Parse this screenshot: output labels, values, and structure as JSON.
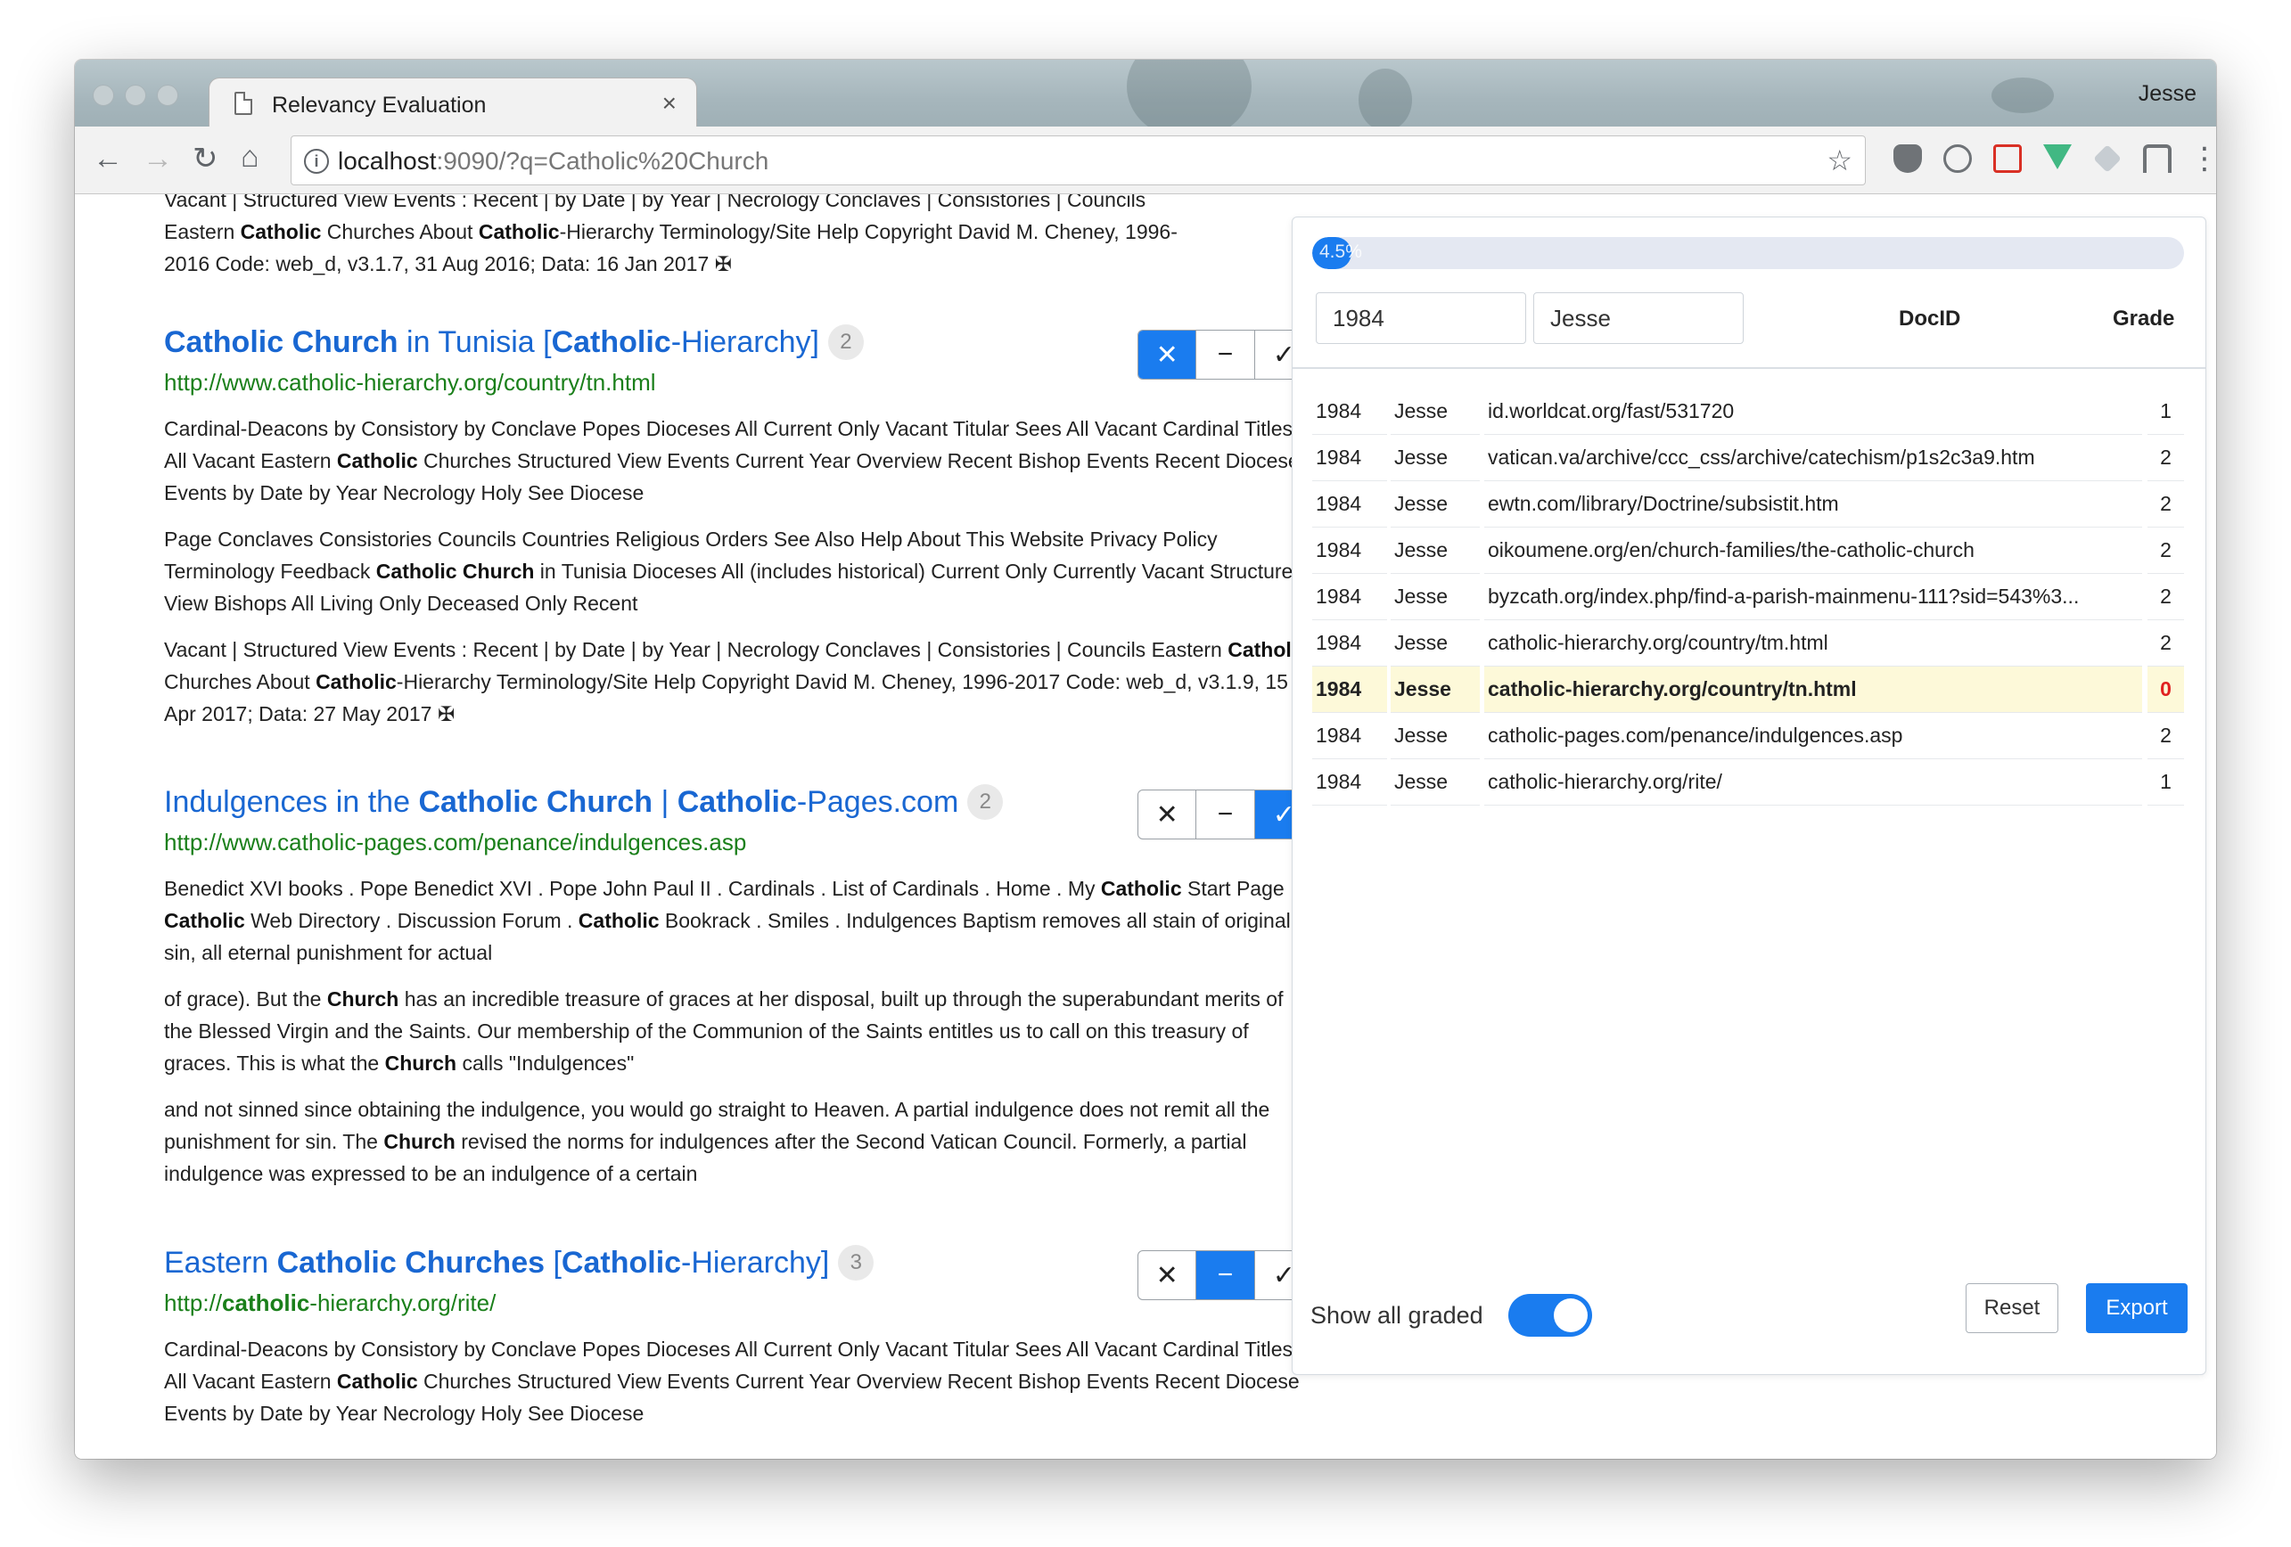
{
  "browser": {
    "tab_title": "Relevancy Evaluation",
    "tab_close": "×",
    "profile_name": "Jesse",
    "url_host": "localhost",
    "url_rest": ":9090/?q=Catholic%20Church"
  },
  "results": {
    "top_fragment": {
      "line1": "Vacant | Structured View Events : Recent | by Date | by Year | Necrology Conclaves | Consistories | Councils",
      "line2_a": "Eastern ",
      "line2_b": "Catholic",
      "line2_c": " Churches About ",
      "line2_d": "Catholic",
      "line2_e": "-Hierarchy Terminology/Site Help Copyright David M. Cheney, 1996-",
      "line3": "2016 Code: web_d, v3.1.7, 31 Aug 2016; Data: 16 Jan 2017 ✠"
    },
    "r1": {
      "title_a": "Catholic Church",
      "title_b": " in Tunisia [",
      "title_c": "Catholic",
      "title_d": "-Hierarchy]",
      "badge": "2",
      "url": "http://www.catholic-hierarchy.org/country/tn.html",
      "p1_a": "Cardinal-Deacons by Consistory by Conclave Popes Dioceses All Current Only Vacant Titular Sees All Vacant Cardinal Titles All Vacant Eastern ",
      "p1_b": "Catholic",
      "p1_c": " Churches Structured View Events Current Year Overview Recent Bishop Events Recent Diocese Events by Date by Year Necrology Holy See Diocese",
      "p2_a": "Page Conclaves Consistories Councils Countries Religious Orders See Also Help About This Website Privacy Policy Terminology Feedback ",
      "p2_b": "Catholic Church",
      "p2_c": " in Tunisia Dioceses All (includes historical) Current Only Currently Vacant Structured View Bishops All Living Only Deceased Only Recent",
      "p3_a": "Vacant | Structured View Events : Recent | by Date | by Year | Necrology Conclaves | Consistories | Councils Eastern ",
      "p3_b": "Catholic",
      "p3_c": " Churches About ",
      "p3_d": "Catholic",
      "p3_e": "-Hierarchy Terminology/Site Help Copyright David M. Cheney, 1996-2017 Code: web_d, v3.1.9, 15 Apr 2017; Data: 27 May 2017 ✠"
    },
    "r2": {
      "title_a": "Indulgences in the ",
      "title_b": "Catholic Church",
      "title_c": " | ",
      "title_d": "Catholic",
      "title_e": "-Pages.com",
      "badge": "2",
      "url": "http://www.catholic-pages.com/penance/indulgences.asp",
      "p1_a": "Benedict XVI books  .  Pope Benedict XVI  .  Pope John Paul II  .  Cardinals  .  List of Cardinals  .  Home  .  My ",
      "p1_b": "Catholic",
      "p1_c": " Start Page  .  ",
      "p1_d": "Catholic",
      "p1_e": " Web Directory  .  Discussion Forum  .  ",
      "p1_f": "Catholic",
      "p1_g": " Bookrack  .  Smiles  .  Indulgences Baptism removes all stain of original sin, all eternal punishment for actual",
      "p2_a": "of grace). But the ",
      "p2_b": "Church",
      "p2_c": " has an incredible treasure of graces at her disposal, built up through the superabundant merits of the Blessed Virgin and the Saints. Our membership of the Communion of the Saints entitles us to call on this treasury of graces. This is what the ",
      "p2_d": "Church",
      "p2_e": " calls \"Indulgences\"",
      "p3_a": "and not sinned since obtaining the indulgence, you would go straight to Heaven. A partial indulgence does not remit all the punishment for sin. The ",
      "p3_b": "Church",
      "p3_c": " revised the norms for indulgences after the Second Vatican Council. Formerly, a partial indulgence was expressed to be an indulgence of a certain"
    },
    "r3": {
      "title_a": "Eastern ",
      "title_b": "Catholic Churches",
      "title_c": " [",
      "title_d": "Catholic",
      "title_e": "-Hierarchy]",
      "badge": "3",
      "url_a": "http://",
      "url_b": "catholic",
      "url_c": "-hierarchy.org/rite/",
      "p1_a": "Cardinal-Deacons by Consistory by Conclave Popes Dioceses All Current Only Vacant Titular Sees All Vacant Cardinal Titles All Vacant Eastern ",
      "p1_b": "Catholic",
      "p1_c": " Churches Structured View Events Current Year Overview Recent Bishop Events Recent Diocese Events by Date by Year Necrology Holy See Diocese"
    },
    "grade_icons": {
      "x": "✕",
      "minus": "−",
      "check": "✓"
    }
  },
  "panel": {
    "progress_label": "4.5%",
    "progress_value": 4.5,
    "year_value": "1984",
    "user_value": "Jesse",
    "docid_header": "DocID",
    "grade_header": "Grade",
    "rows": [
      {
        "year": "1984",
        "user": "Jesse",
        "doc": "id.worldcat.org/fast/531720",
        "grade": "1"
      },
      {
        "year": "1984",
        "user": "Jesse",
        "doc": "vatican.va/archive/ccc_css/archive/catechism/p1s2c3a9.htm",
        "grade": "2"
      },
      {
        "year": "1984",
        "user": "Jesse",
        "doc": "ewtn.com/library/Doctrine/subsistit.htm",
        "grade": "2"
      },
      {
        "year": "1984",
        "user": "Jesse",
        "doc": "oikoumene.org/en/church-families/the-catholic-church",
        "grade": "2"
      },
      {
        "year": "1984",
        "user": "Jesse",
        "doc": "byzcath.org/index.php/find-a-parish-mainmenu-111?sid=543%3...",
        "grade": "2"
      },
      {
        "year": "1984",
        "user": "Jesse",
        "doc": "catholic-hierarchy.org/country/tm.html",
        "grade": "2"
      },
      {
        "year": "1984",
        "user": "Jesse",
        "doc": "catholic-hierarchy.org/country/tn.html",
        "grade": "0"
      },
      {
        "year": "1984",
        "user": "Jesse",
        "doc": "catholic-pages.com/penance/indulgences.asp",
        "grade": "2"
      },
      {
        "year": "1984",
        "user": "Jesse",
        "doc": "catholic-hierarchy.org/rite/",
        "grade": "1"
      }
    ],
    "show_all_label": "Show all graded",
    "reset_label": "Reset",
    "export_label": "Export"
  },
  "colors": {
    "accent": "#1a7cef",
    "link": "#1967d2",
    "url_green": "#1a7f1a",
    "highlight_row": "#fdf9d9",
    "zero_grade": "#e02020"
  }
}
